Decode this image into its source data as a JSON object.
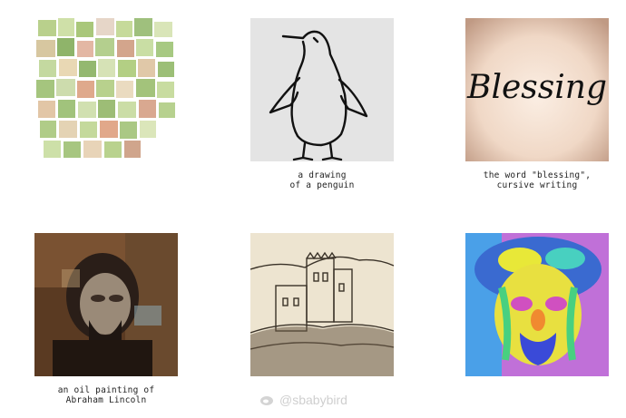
{
  "images": [
    {
      "id": "mosaic",
      "caption_lines": []
    },
    {
      "id": "penguin",
      "caption_lines": [
        "a drawing",
        "of a penguin"
      ]
    },
    {
      "id": "blessing",
      "caption_lines": [
        "the word \"blessing\",",
        "cursive writing"
      ],
      "art_text": "Blessing"
    },
    {
      "id": "lincoln",
      "caption_lines": [
        "an oil painting of",
        "Abraham Lincoln"
      ]
    },
    {
      "id": "castle",
      "caption_lines": []
    },
    {
      "id": "popart",
      "caption_lines": []
    }
  ],
  "watermark": {
    "text": "@sbabybird"
  }
}
